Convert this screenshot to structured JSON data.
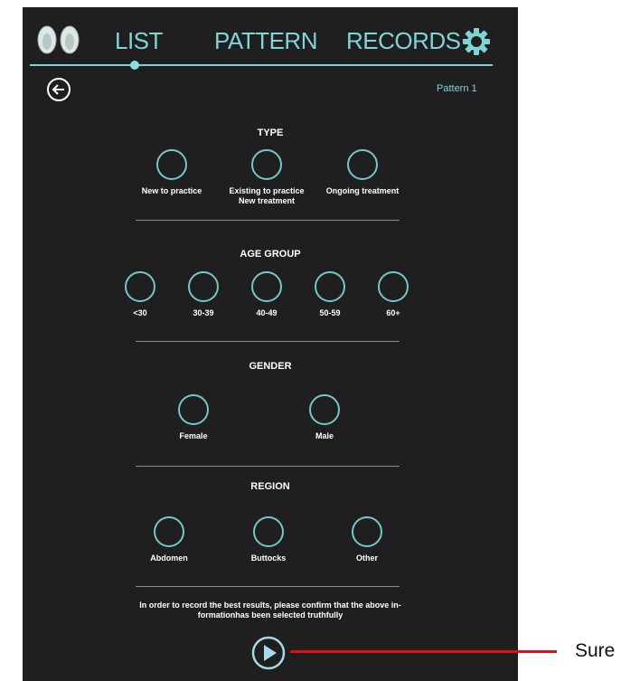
{
  "nav": {
    "tabs": [
      "LIST",
      "PATTERN",
      "RECORDS"
    ],
    "active_tab": "LIST",
    "pattern_label": "Pattern 1"
  },
  "type": {
    "title": "TYPE",
    "options": [
      "New to practice",
      "Existing to practice New treatment",
      "Ongoing treatment"
    ]
  },
  "age_group": {
    "title": "AGE GROUP",
    "options": [
      "<30",
      "30-39",
      "40-49",
      "50-59",
      "60+"
    ]
  },
  "gender": {
    "title": "GENDER",
    "options": [
      "Female",
      "Male"
    ]
  },
  "region": {
    "title": "REGION",
    "options": [
      "Abdomen",
      "Buttocks",
      "Other"
    ]
  },
  "notice": "In order to record the best results, please confirm that the above in-formationhas been selected truthfully",
  "callout": {
    "label": "Sure"
  },
  "colors": {
    "background": "#1f1f1f",
    "accent": "#7fd4d4",
    "callout_line": "#e0101a"
  }
}
